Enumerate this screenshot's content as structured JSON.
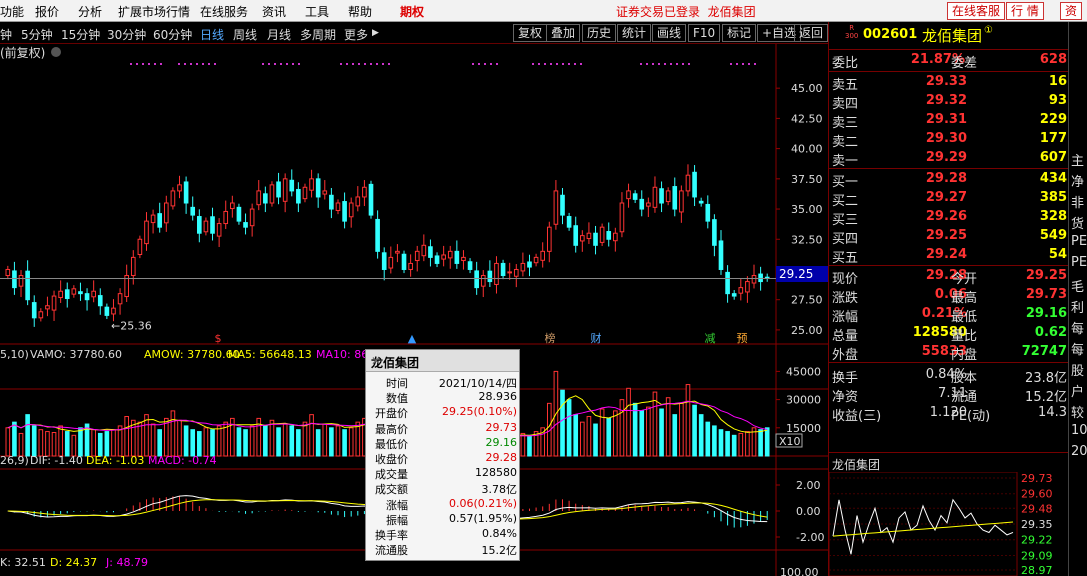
{
  "menu": {
    "items": [
      "功能",
      "报价",
      "分析",
      "扩展市场行情",
      "在线服务",
      "资讯",
      "工具",
      "帮助"
    ],
    "highlight": "期权",
    "status": "证券交易已登录",
    "company": "龙佰集团",
    "btn_service": "在线客服",
    "btn_quote": "行 情",
    "btn_trade": "资"
  },
  "toolbar": {
    "periods": [
      "钟",
      "5分钟",
      "15分钟",
      "30分钟",
      "60分钟",
      "日线",
      "周线",
      "月线",
      "多周期",
      "更多"
    ],
    "active_period": "日线",
    "more_arrow": "▶",
    "tools": [
      "复权",
      "叠加",
      "历史",
      "统计",
      "画线",
      "F10",
      "标记",
      "+自选",
      "返回"
    ]
  },
  "chart": {
    "adj_label": "(前复权)",
    "low_label": "←25.36",
    "y_ticks": [
      "45.00",
      "42.50",
      "40.00",
      "37.50",
      "35.00",
      "32.50",
      "29.25",
      "27.50",
      "25.00"
    ],
    "event_marks": [
      {
        "label": "$",
        "color": "#f33"
      },
      {
        "label": "▲",
        "color": "#39f"
      },
      {
        "label": "榜",
        "color": "#c96"
      },
      {
        "label": "财",
        "color": "#5af"
      },
      {
        "label": "减",
        "color": "#3c3"
      },
      {
        "label": "预",
        "color": "#fa3"
      }
    ],
    "vol_title": "5,10)",
    "vol_items": [
      {
        "text": "VAMO: 37780.60",
        "color": "#ddd"
      },
      {
        "text": "AMOW: 37780.60",
        "color": "#ff0"
      },
      {
        "text": "MA5: 56648.13",
        "color": "#ff0"
      },
      {
        "text": "MA10: 8656...",
        "color": "#f0f"
      }
    ],
    "vol_ticks": [
      "45000",
      "30000",
      "15000"
    ],
    "vol_unit": "X10",
    "macd_title": "26,9)",
    "macd_items": [
      {
        "text": "DIF: -1.40",
        "color": "#ddd"
      },
      {
        "text": "DEA: -1.03",
        "color": "#ff0"
      },
      {
        "text": "MACD: -0.74",
        "color": "#f0f"
      }
    ],
    "macd_ticks": [
      "2.00",
      "0.00",
      "-2.00"
    ],
    "kdj_items": [
      {
        "text": "K: 32.51",
        "color": "#ddd"
      },
      {
        "text": "D: 24.37",
        "color": "#ff0"
      },
      {
        "text": "J: 48.79",
        "color": "#f0f"
      }
    ],
    "kdj_tick": "100.00"
  },
  "chart_data": {
    "type": "candlestick",
    "ylim": [
      24,
      47
    ],
    "current": 29.25,
    "low_marker": 25.36,
    "closes": [
      30.0,
      28.5,
      29.5,
      27.5,
      26.0,
      26.5,
      27.0,
      27.8,
      28.2,
      27.6,
      28.4,
      28.0,
      27.5,
      28.2,
      27.0,
      26.2,
      26.8,
      28.0,
      29.5,
      31.0,
      32.5,
      34.0,
      34.5,
      33.5,
      35.5,
      36.5,
      37.0,
      35.5,
      34.5,
      33.0,
      34.0,
      33.0,
      33.8,
      34.8,
      35.5,
      34.0,
      33.5,
      35.0,
      36.5,
      35.5,
      37.0,
      36.0,
      37.5,
      36.5,
      35.5,
      36.8,
      37.5,
      36.0,
      36.5,
      35.0,
      35.5,
      34.0,
      35.5,
      36.0,
      36.8,
      34.5,
      31.5,
      30.0,
      31.0,
      31.5,
      30.0,
      30.5,
      31.5,
      32.0,
      31.0,
      30.5,
      31.2,
      31.5,
      30.5,
      31.0,
      30.0,
      28.5,
      29.5,
      29.0,
      30.5,
      29.5,
      29.8,
      30.0,
      30.5,
      30.2,
      31.0,
      31.5,
      33.5,
      36.5,
      34.5,
      33.5,
      32.0,
      32.8,
      33.0,
      32.0,
      33.5,
      32.5,
      33.0,
      35.5,
      36.5,
      35.8,
      35.0,
      35.5,
      36.8,
      35.5,
      36.5,
      35.0,
      36.5,
      37.8,
      36.0,
      35.5,
      34.0,
      32.0,
      30.0,
      28.0,
      27.8,
      28.5,
      29.0,
      29.5,
      29.0,
      29.28
    ],
    "volumes": [
      15000,
      18000,
      12000,
      22000,
      16000,
      14000,
      13000,
      12500,
      16000,
      13000,
      11000,
      15000,
      17000,
      14000,
      12000,
      13000,
      14000,
      16000,
      21000,
      19000,
      18000,
      22000,
      17000,
      14000,
      20000,
      24000,
      19000,
      16000,
      14000,
      13000,
      15000,
      14000,
      16000,
      18000,
      20000,
      15000,
      14000,
      16000,
      20000,
      16000,
      19000,
      15000,
      17000,
      16000,
      14000,
      18000,
      22000,
      14000,
      17000,
      15000,
      16000,
      14000,
      15000,
      18000,
      20000,
      16000,
      12000,
      10000,
      11000,
      12000,
      10000,
      11000,
      13000,
      14000,
      12000,
      11000,
      12000,
      13000,
      11000,
      12000,
      10000,
      9000,
      11000,
      10000,
      12000,
      10000,
      11000,
      11000,
      12000,
      11000,
      13000,
      15000,
      28000,
      45000,
      35000,
      30000,
      22000,
      18000,
      21000,
      17000,
      25000,
      20000,
      24000,
      30000,
      36000,
      28000,
      24000,
      26000,
      34000,
      25000,
      31000,
      22000,
      28000,
      38000,
      27000,
      22000,
      18000,
      16000,
      14000,
      13000,
      11000,
      12000,
      13000,
      15000,
      14000,
      15000
    ],
    "vol_ylim": [
      0,
      50000
    ],
    "macd_ylim": [
      -3,
      3
    ]
  },
  "quote": {
    "code": "002601",
    "name": "龙佰集团",
    "badge_r": "R",
    "badge_300": "300",
    "weibi_label": "委比",
    "weibi": "21.87%",
    "weicha_label": "委差",
    "weicha": "628",
    "asks": [
      {
        "label": "卖五",
        "price": "29.33",
        "vol": "16"
      },
      {
        "label": "卖四",
        "price": "29.32",
        "vol": "93"
      },
      {
        "label": "卖三",
        "price": "29.31",
        "vol": "229"
      },
      {
        "label": "卖二",
        "price": "29.30",
        "vol": "177"
      },
      {
        "label": "卖一",
        "price": "29.29",
        "vol": "607"
      }
    ],
    "bids": [
      {
        "label": "买一",
        "price": "29.28",
        "vol": "434"
      },
      {
        "label": "买二",
        "price": "29.27",
        "vol": "385"
      },
      {
        "label": "买三",
        "price": "29.26",
        "vol": "328"
      },
      {
        "label": "买四",
        "price": "29.25",
        "vol": "549"
      },
      {
        "label": "买五",
        "price": "29.24",
        "vol": "54"
      }
    ],
    "stats1": [
      {
        "l1": "现价",
        "v1": "29.28",
        "l2": "今开",
        "v2": "29.25",
        "c1": "#f33",
        "c2": "#f33"
      },
      {
        "l1": "涨跌",
        "v1": "0.06",
        "l2": "最高",
        "v2": "29.73",
        "c1": "#f33",
        "c2": "#f33"
      },
      {
        "l1": "涨幅",
        "v1": "0.21%",
        "l2": "最低",
        "v2": "29.16",
        "c1": "#f33",
        "c2": "#3f3"
      },
      {
        "l1": "总量",
        "v1": "128580",
        "l2": "量比",
        "v2": "0.62",
        "c1": "#ff0",
        "c2": "#3f3"
      },
      {
        "l1": "外盘",
        "v1": "55833",
        "l2": "内盘",
        "v2": "72747",
        "c1": "#f33",
        "c2": "#3f3"
      }
    ],
    "stats2": [
      {
        "l1": "换手",
        "v1": "0.84%",
        "l2": "股本",
        "v2": "23.8亿"
      },
      {
        "l1": "净资",
        "v1": "7.11",
        "l2": "流通",
        "v2": "15.2亿"
      },
      {
        "l1": "收益(三)",
        "v1": "1.120",
        "l2": "PE(动)",
        "v2": "14.3"
      }
    ],
    "mini_title": "龙佰集团",
    "mini_ticks": [
      "29.73",
      "29.60",
      "29.48",
      "29.35",
      "29.22",
      "29.09",
      "28.97"
    ]
  },
  "edge": [
    "主",
    "净",
    "非",
    "货",
    "PE",
    "PE",
    "毛",
    "利",
    "每",
    "每",
    "股",
    "户",
    "较",
    "10",
    "20"
  ],
  "popup": {
    "title": "龙佰集团",
    "close": "✕",
    "rows": [
      {
        "label": "时间",
        "value": "2021/10/14/四",
        "color": "#000"
      },
      {
        "label": "数值",
        "value": "28.936",
        "color": "#000"
      },
      {
        "label": "开盘价",
        "value": "29.25(0.10%)",
        "color": "#d00"
      },
      {
        "label": "最高价",
        "value": "29.73",
        "color": "#d00"
      },
      {
        "label": "最低价",
        "value": "29.16",
        "color": "#080"
      },
      {
        "label": "收盘价",
        "value": "29.28",
        "color": "#d00"
      },
      {
        "label": "成交量",
        "value": "128580",
        "color": "#000"
      },
      {
        "label": "成交额",
        "value": "3.78亿",
        "color": "#000"
      },
      {
        "label": "涨幅",
        "value": "0.06(0.21%)",
        "color": "#d00"
      },
      {
        "label": "振幅",
        "value": "0.57(1.95%)",
        "color": "#000"
      },
      {
        "label": "换手率",
        "value": "0.84%",
        "color": "#000"
      },
      {
        "label": "流通股",
        "value": "15.2亿",
        "color": "#000"
      }
    ]
  }
}
